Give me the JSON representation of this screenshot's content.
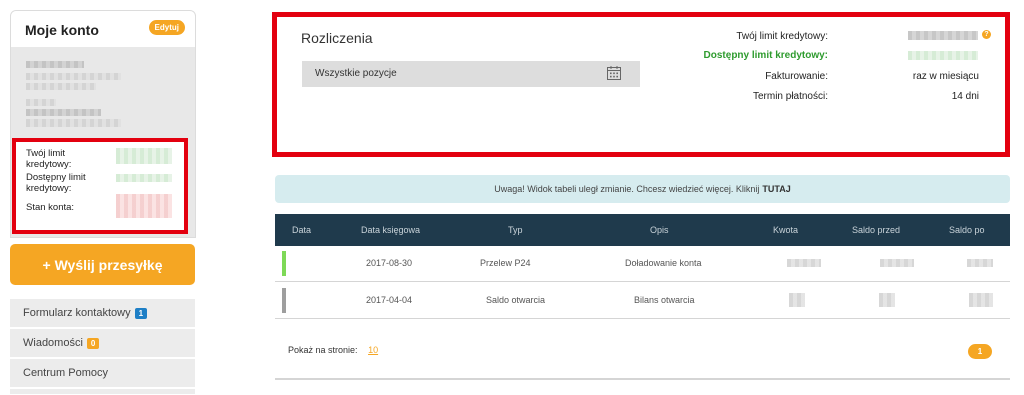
{
  "account": {
    "title": "Moje konto",
    "edit_label": "Edytuj",
    "limit_label": "Twój limit kredytowy:",
    "available_label": "Dostępny limit kredytowy:",
    "balance_label": "Stan konta:"
  },
  "send_button": "+ Wyślij przesyłkę",
  "menu": [
    {
      "label": "Formularz kontaktowy",
      "badge": "1"
    },
    {
      "label": "Wiadomości",
      "badge": "0"
    },
    {
      "label": "Centrum Pomocy"
    }
  ],
  "billing": {
    "title": "Rozliczenia",
    "filter_value": "Wszystkie pozycje",
    "credit_limit_label": "Twój limit kredytowy:",
    "available_limit_label": "Dostępny limit kredytowy:",
    "invoicing_label": "Fakturowanie:",
    "invoicing_value": "raz w miesiącu",
    "payment_term_label": "Termin płatności:",
    "payment_term_value": "14 dni",
    "help": "?"
  },
  "notice": {
    "text": "Uwaga! Widok tabeli uległ zmianie. Chcesz wiedzieć więcej. Kliknij",
    "link": "TUTAJ"
  },
  "table": {
    "columns": [
      "Data",
      "Data księgowa",
      "Typ",
      "Opis",
      "Kwota",
      "Saldo przed",
      "Saldo po"
    ],
    "rows": [
      {
        "date": "",
        "booking_date": "2017-08-30",
        "type": "Przelew P24",
        "desc": "Doładowanie konta",
        "color": "#7ed957"
      },
      {
        "date": "",
        "booking_date": "2017-04-04",
        "type": "Saldo otwarcia",
        "desc": "Bilans otwarcia",
        "color": "#9e9e9e"
      }
    ]
  },
  "pagination": {
    "per_page_label": "Pokaż na stronie:",
    "per_page_value": "10",
    "current_page": "1"
  },
  "colors": {
    "accent": "#f5a623",
    "highlight_border": "#e3000f",
    "table_header": "#1f3a4c",
    "available_green": "#2e9b2e"
  }
}
